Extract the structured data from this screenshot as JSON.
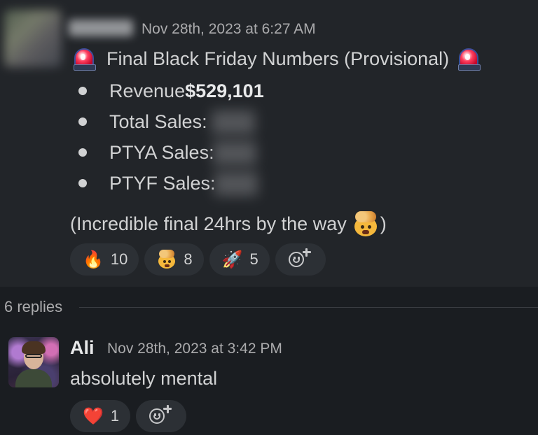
{
  "message": {
    "timestamp": "Nov 28th, 2023 at 6:27 AM",
    "title": "Final Black Friday Numbers (Provisional)",
    "bullets": [
      {
        "label": "Revenue ",
        "value": "$529,101"
      },
      {
        "label": "Total Sales:",
        "value": ""
      },
      {
        "label": "PTYA Sales:",
        "value": ""
      },
      {
        "label": "PTYF Sales:",
        "value": ""
      }
    ],
    "note_before": "(Incredible final 24hrs by the way",
    "note_after": ")",
    "reactions": [
      {
        "emoji": "🔥",
        "count": "10"
      },
      {
        "emoji": "exploding-head",
        "count": "8"
      },
      {
        "emoji": "🚀",
        "count": "5"
      }
    ]
  },
  "thread": {
    "replies_label": "6 replies"
  },
  "reply": {
    "author": "Ali",
    "timestamp": "Nov 28th, 2023 at 3:42 PM",
    "text": "absolutely mental",
    "reactions": [
      {
        "emoji": "❤️",
        "count": "1"
      }
    ]
  },
  "colors": {
    "background": "#1a1d21",
    "highlighted_message": "#222529",
    "reaction_pill": "#2c3035",
    "muted_text": "#ababad"
  }
}
